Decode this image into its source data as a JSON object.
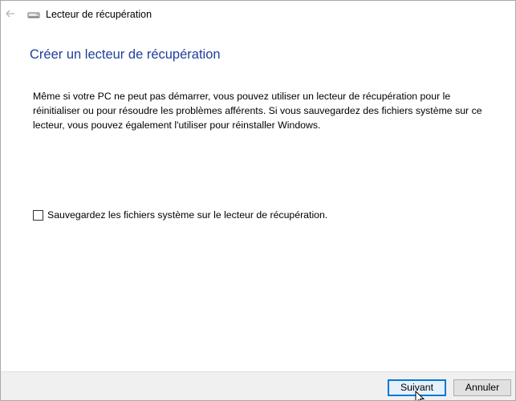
{
  "window": {
    "title": "Lecteur de récupération"
  },
  "page": {
    "title": "Créer un lecteur de récupération",
    "description": "Même si votre PC ne peut pas démarrer, vous pouvez utiliser un lecteur de récupération pour le réinitialiser ou pour résoudre les problèmes afférents. Si vous sauvegardez des fichiers système sur ce lecteur, vous pouvez également l'utiliser pour réinstaller Windows."
  },
  "backup_option": {
    "label": "Sauvegardez les fichiers système sur le lecteur de récupération.",
    "checked": false
  },
  "buttons": {
    "next_label": "Suivant",
    "cancel_label": "Annuler"
  },
  "icons": {
    "back": "back-arrow-icon",
    "drive": "drive-icon",
    "cursor": "mouse-pointer-icon"
  },
  "colors": {
    "title": "#1f3f9a",
    "default_button_border": "#0078d7",
    "footer_background": "#f0f0f0"
  }
}
